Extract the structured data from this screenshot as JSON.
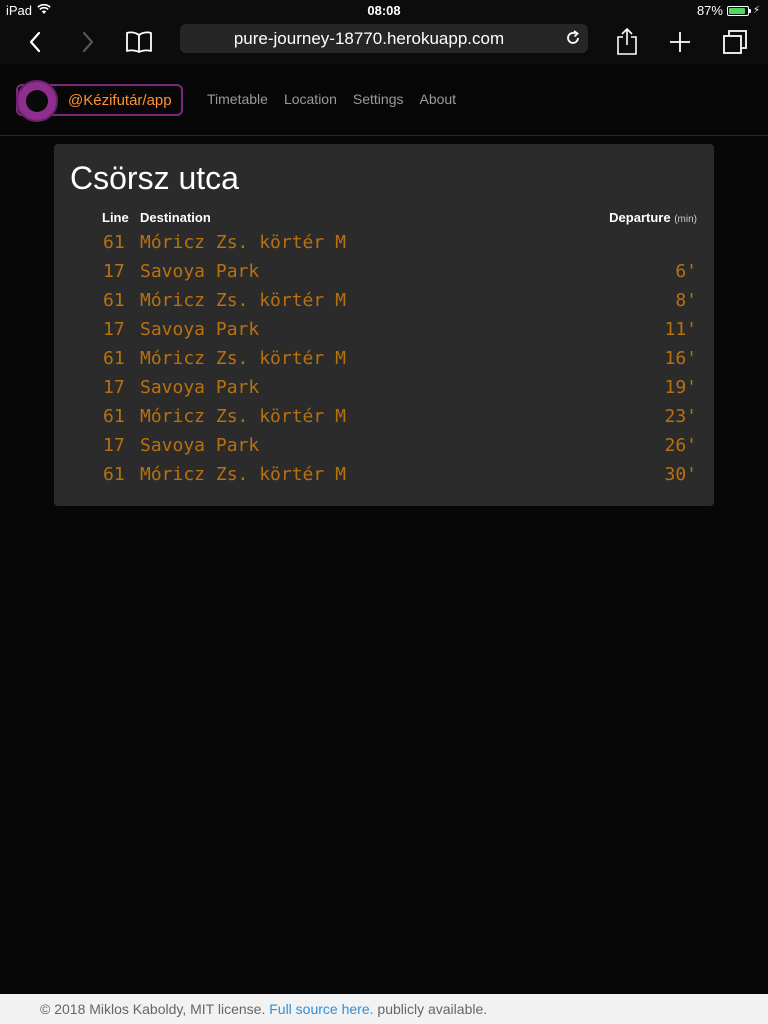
{
  "status_bar": {
    "device": "iPad",
    "time": "08:08",
    "battery_percent": "87%",
    "battery_level": 0.87,
    "battery_color": "#4cd964"
  },
  "browser": {
    "url": "pure-journey-18770.herokuapp.com",
    "icons": [
      "back-icon",
      "forward-icon",
      "bookmarks-icon",
      "reload-icon",
      "share-icon",
      "new-tab-icon",
      "tabs-icon"
    ]
  },
  "nav": {
    "brand": "@Kézifutár/app",
    "brand_color": "#ff9233",
    "links": [
      "Timetable",
      "Location",
      "Settings",
      "About"
    ]
  },
  "timetable": {
    "stop_name": "Csörsz utca",
    "headers": {
      "line": "Line",
      "destination": "Destination",
      "departure": "Departure",
      "unit": "(min)"
    },
    "departures": [
      {
        "line": "61",
        "destination": "Móricz Zs. körtér M",
        "minutes": ""
      },
      {
        "line": "17",
        "destination": "Savoya Park",
        "minutes": "6'"
      },
      {
        "line": "61",
        "destination": "Móricz Zs. körtér M",
        "minutes": "8'"
      },
      {
        "line": "17",
        "destination": "Savoya Park",
        "minutes": "11'"
      },
      {
        "line": "61",
        "destination": "Móricz Zs. körtér M",
        "minutes": "16'"
      },
      {
        "line": "17",
        "destination": "Savoya Park",
        "minutes": "19'"
      },
      {
        "line": "61",
        "destination": "Móricz Zs. körtér M",
        "minutes": "23'"
      },
      {
        "line": "17",
        "destination": "Savoya Park",
        "minutes": "26'"
      },
      {
        "line": "61",
        "destination": "Móricz Zs. körtér M",
        "minutes": "30'"
      }
    ],
    "led_color": "#b9710f"
  },
  "footer": {
    "copyright": "© 2018 Miklos Kaboldy, MIT license.",
    "link_text": "Full source here.",
    "suffix": "publicly available."
  }
}
